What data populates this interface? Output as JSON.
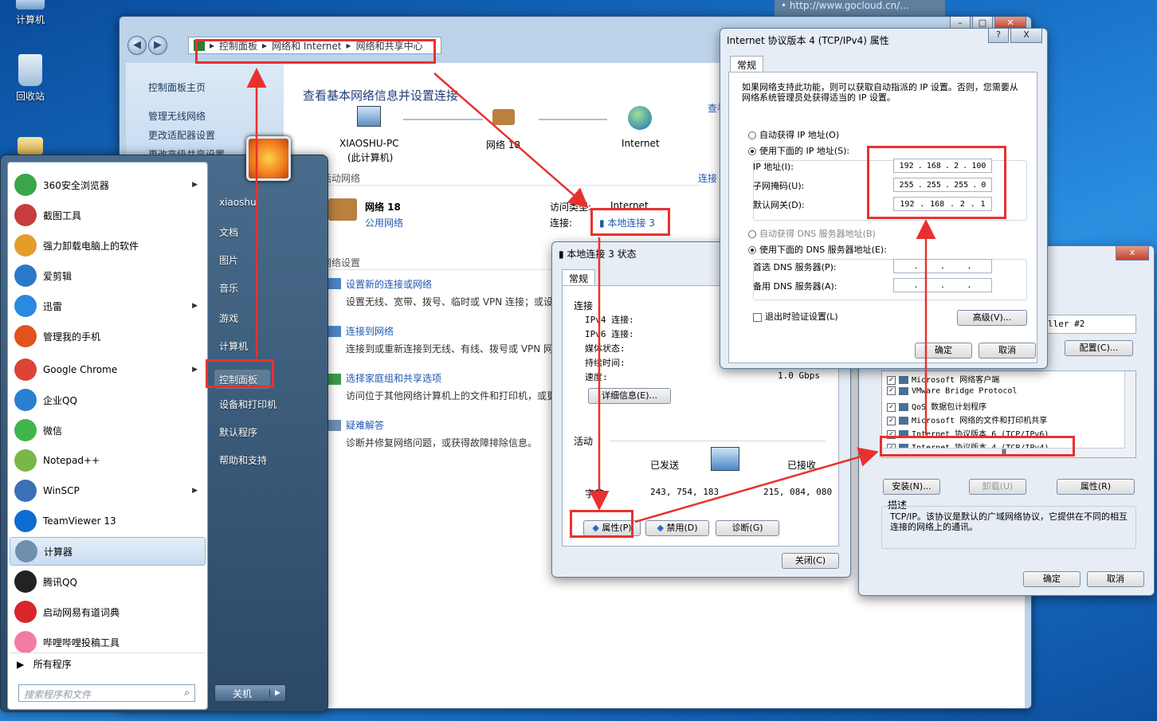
{
  "desktop": {
    "icons": [
      {
        "label": "计算机"
      },
      {
        "label": "回收站"
      }
    ],
    "url_hint": "• http://www.gocloud.cn/..."
  },
  "explorer": {
    "breadcrumb": [
      "控制面板",
      "网络和 Internet",
      "网络和共享中心"
    ],
    "left_links": [
      "控制面板主页",
      "管理无线网络",
      "更改适配器设置",
      "更改高级共享设置"
    ],
    "heading": "查看基本网络信息并设置连接",
    "view_full_map": "查看",
    "map": {
      "pc_name": "XIAOSHU-PC",
      "pc_sub": "(此计算机)",
      "network": "网络  18",
      "internet": "Internet"
    },
    "active_label": "查看活动网络",
    "connect_link": "连接",
    "network_name": "网络  18",
    "network_type": "公用网络",
    "access_type_label": "访问类型:",
    "access_type_value": "Internet",
    "connection_label": "连接:",
    "connection_value": "本地连接 3",
    "change_settings": "更改网络设置",
    "tasks": [
      {
        "title": "设置新的连接或网络",
        "desc": "设置无线、宽带、拨号、临时或 VPN 连接；或设"
      },
      {
        "title": "连接到网络",
        "desc": "连接到或重新连接到无线、有线、拨号或 VPN 网"
      },
      {
        "title": "选择家庭组和共享选项",
        "desc": "访问位于其他网络计算机上的文件和打印机，或更"
      },
      {
        "title": "疑难解答",
        "desc": "诊断并修复网络问题，或获得故障排除信息。"
      }
    ]
  },
  "start_menu": {
    "programs": [
      {
        "label": "360安全浏览器",
        "arrow": true,
        "color": "#3aa54a"
      },
      {
        "label": "截图工具",
        "arrow": false,
        "color": "#c83c3c"
      },
      {
        "label": "强力卸载电脑上的软件",
        "arrow": false,
        "color": "#e49c2a"
      },
      {
        "label": "爱剪辑",
        "arrow": false,
        "color": "#2a78c8"
      },
      {
        "label": "迅雷",
        "arrow": true,
        "color": "#2a8ae0"
      },
      {
        "label": "管理我的手机",
        "arrow": false,
        "color": "#e2521f"
      },
      {
        "label": "Google Chrome",
        "arrow": true,
        "color": "#db4437"
      },
      {
        "label": "企业QQ",
        "arrow": false,
        "color": "#2a7fd0"
      },
      {
        "label": "微信",
        "arrow": false,
        "color": "#3fb54a"
      },
      {
        "label": "Notepad++",
        "arrow": false,
        "color": "#7ab648"
      },
      {
        "label": "WinSCP",
        "arrow": true,
        "color": "#3b6fb8"
      },
      {
        "label": "TeamViewer 13",
        "arrow": false,
        "color": "#0e6bd0"
      },
      {
        "label": "计算器",
        "arrow": false,
        "color": "#6f8faf"
      },
      {
        "label": "腾讯QQ",
        "arrow": false,
        "color": "#222222"
      },
      {
        "label": "启动网易有道词典",
        "arrow": false,
        "color": "#d8262a"
      },
      {
        "label": "哔哩哔哩投稿工具",
        "arrow": false,
        "color": "#f37ba4"
      }
    ],
    "all_programs": "所有程序",
    "search_placeholder": "搜索程序和文件",
    "user": "xiaoshu",
    "right_items": [
      "文档",
      "图片",
      "音乐",
      "游戏",
      "计算机",
      "控制面板",
      "设备和打印机",
      "默认程序",
      "帮助和支持"
    ],
    "shutdown": "关机"
  },
  "status_dialog": {
    "title": "本地连接 3 状态",
    "tab": "常规",
    "section_connection": "连接",
    "rows": [
      {
        "label": "IPv4 连接:",
        "value": ""
      },
      {
        "label": "IPv6 连接:",
        "value": ""
      },
      {
        "label": "媒体状态:",
        "value": ""
      },
      {
        "label": "持续时间:",
        "value": ""
      },
      {
        "label": "速度:",
        "value": "1.0 Gbps"
      }
    ],
    "details_btn": "详细信息(E)...",
    "section_activity": "活动",
    "sent_label": "已发送",
    "received_label": "已接收",
    "bytes_label": "字节:",
    "bytes_sent": "243, 754, 183",
    "bytes_received": "215, 084, 080",
    "btn_properties": "属性(P)",
    "btn_disable": "禁用(D)",
    "btn_diagnose": "诊断(G)",
    "btn_close": "关闭(C)"
  },
  "props_dialog": {
    "title": "x",
    "adapter_text": "ller #2",
    "configure_btn": "配置(C)...",
    "items": [
      {
        "label": "Microsoft 网络客户端",
        "checked": true
      },
      {
        "label": "VMware Bridge Protocol",
        "checked": true
      },
      {
        "label": "QoS 数据包计划程序",
        "checked": true
      },
      {
        "label": "Microsoft 网络的文件和打印机共享",
        "checked": true
      },
      {
        "label": "Internet 协议版本 6 (TCP/IPv6)",
        "checked": true
      },
      {
        "label": "Internet 协议版本 4 (TCP/IPv4)",
        "checked": true
      }
    ],
    "scroll_mark": "Ⅲ",
    "btn_install": "安装(N)...",
    "btn_uninstall": "卸载(U)",
    "btn_properties": "属性(R)",
    "desc_label": "描述",
    "desc_text": "TCP/IP。该协议是默认的广域网络协议，它提供在不同的相互连接的网络上的通讯。",
    "btn_ok": "确定",
    "btn_cancel": "取消"
  },
  "ipv4_dialog": {
    "title": "Internet 协议版本 4 (TCP/IPv4) 属性",
    "help": "?",
    "close": "X",
    "tab": "常规",
    "intro": "如果网络支持此功能，则可以获取自动指派的 IP 设置。否则，您需要从网络系统管理员处获得适当的 IP 设置。",
    "auto_ip": "自动获得 IP 地址(O)",
    "manual_ip": "使用下面的 IP 地址(S):",
    "ip_label": "IP 地址(I):",
    "ip": [
      "192",
      "168",
      "2",
      "100"
    ],
    "mask_label": "子网掩码(U):",
    "mask": [
      "255",
      "255",
      "255",
      "0"
    ],
    "gw_label": "默认网关(D):",
    "gw": [
      "192",
      "168",
      "2",
      "1"
    ],
    "auto_dns": "自动获得 DNS 服务器地址(B)",
    "manual_dns": "使用下面的 DNS 服务器地址(E):",
    "dns1_label": "首选 DNS 服务器(P):",
    "dns2_label": "备用 DNS 服务器(A):",
    "dot": ".",
    "validate": "退出时验证设置(L)",
    "advanced": "高级(V)...",
    "btn_ok": "确定",
    "btn_cancel": "取消"
  },
  "colors": {
    "highlight_red": "#e8312f",
    "link_blue": "#1f58b4",
    "taskbar_blue": "#1a6bc4"
  }
}
